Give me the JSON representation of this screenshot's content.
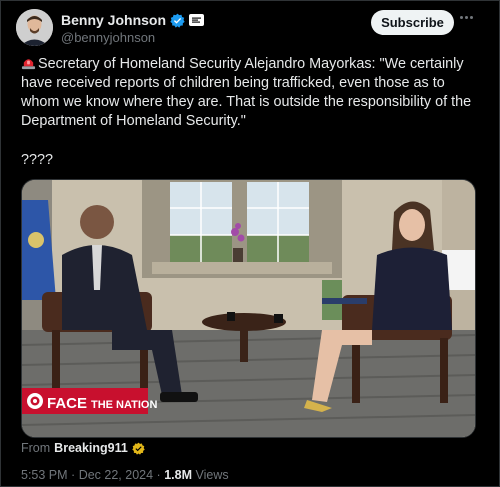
{
  "author": {
    "display_name": "Benny Johnson",
    "handle": "@bennyjohnson"
  },
  "subscribe_label": "Subscribe",
  "tweet": {
    "text": "Secretary of Homeland Security Alejandro Mayorkas: \"We certainly have received reports of children being trafficked, even those as to whom we know where they are. That is outside the responsibility of the Department of Homeland Security.\"",
    "followup": "????",
    "siren_icon": "rotating-light-emoji"
  },
  "media": {
    "logo_prefix": "FACE",
    "logo_suffix": "THE NATION"
  },
  "source": {
    "prefix": "From",
    "name": "Breaking911"
  },
  "meta": {
    "time": "5:53 PM",
    "separator": "·",
    "date": "Dec 22, 2024",
    "views_count": "1.8M",
    "views_label": "Views"
  },
  "colors": {
    "verified_blue": "#1d9bf0",
    "verified_gold": "#e2b719",
    "cbs_red": "#c8102e"
  }
}
